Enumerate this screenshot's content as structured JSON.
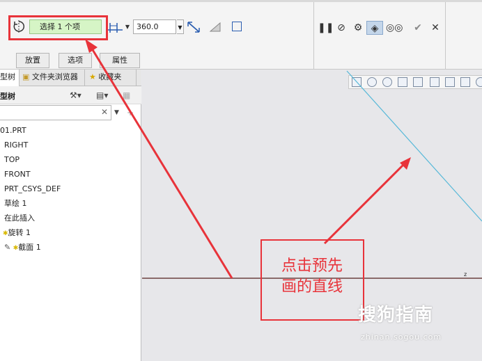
{
  "toolbar": {
    "selection_field": "选择 1 个项",
    "angle_value": "360.0",
    "tabs": [
      {
        "label": "放置"
      },
      {
        "label": "选项"
      },
      {
        "label": "属性"
      }
    ]
  },
  "left_panel": {
    "tabs": [
      {
        "label": "型树"
      },
      {
        "label": "文件夹浏览器"
      },
      {
        "label": "收藏夹"
      }
    ],
    "header_title": "型树",
    "filter_value": "",
    "tree_items": [
      {
        "label": "01.PRT"
      },
      {
        "label": "RIGHT"
      },
      {
        "label": "TOP"
      },
      {
        "label": "FRONT"
      },
      {
        "label": "PRT_CSYS_DEF"
      },
      {
        "label": "草绘 1"
      },
      {
        "label": "在此插入"
      },
      {
        "label": "旋转 1"
      },
      {
        "label": "截面 1"
      }
    ]
  },
  "annotation": {
    "line1": "点击预先",
    "line2": "画的直线"
  },
  "watermark": {
    "brand": "搜狗指南",
    "url": "zhinan.sogou.com"
  },
  "colors": {
    "highlight_red": "#e8333a",
    "selection_green": "#d6f5c6",
    "sketch_line_cyan": "#56b8d8"
  }
}
